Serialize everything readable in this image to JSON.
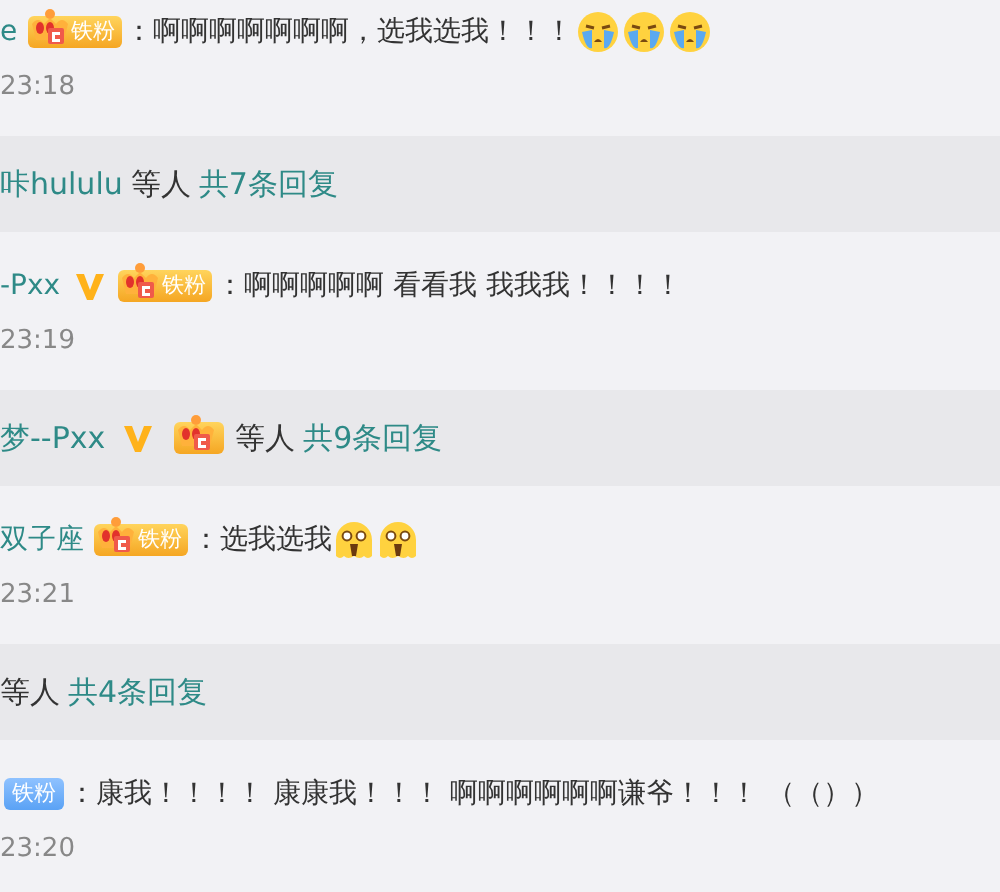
{
  "feed": [
    {
      "kind": "comment",
      "user": "e",
      "verified": false,
      "badge": {
        "kind": "gold",
        "label": "铁粉"
      },
      "text": "：啊啊啊啊啊啊啊，选我选我！！！",
      "emojis": [
        {
          "kind": "crying"
        },
        {
          "kind": "crying"
        },
        {
          "kind": "crying"
        }
      ],
      "time": "23:18"
    },
    {
      "kind": "replies",
      "user": "咔hululu",
      "verified": false,
      "suffix": "等人",
      "count": "共7条回复"
    },
    {
      "kind": "comment",
      "user": "-Pxx",
      "verified": true,
      "badge": {
        "kind": "gold",
        "label": "铁粉"
      },
      "text": "：啊啊啊啊啊 看看我 我我我！！！！",
      "time": "23:19"
    },
    {
      "kind": "replies",
      "user": "梦--Pxx",
      "verified": true,
      "badge": {
        "kind": "gold"
      },
      "suffix": "等人",
      "count": "共9条回复"
    },
    {
      "kind": "comment",
      "user": "双子座",
      "verified": false,
      "badge": {
        "kind": "gold",
        "label": "铁粉"
      },
      "text": "：选我选我",
      "emojis": [
        {
          "kind": "shocked"
        },
        {
          "kind": "shocked"
        }
      ],
      "time": "23:21"
    },
    {
      "kind": "replies",
      "verified": false,
      "suffix": "等人",
      "count": "共4条回复"
    },
    {
      "kind": "comment",
      "verified": false,
      "badge": {
        "kind": "blue",
        "label": "铁粉"
      },
      "text": "：康我！！！！ 康康我！！！ 啊啊啊啊啊啊谦爷！！！ （（））",
      "time": "23:20"
    }
  ]
}
